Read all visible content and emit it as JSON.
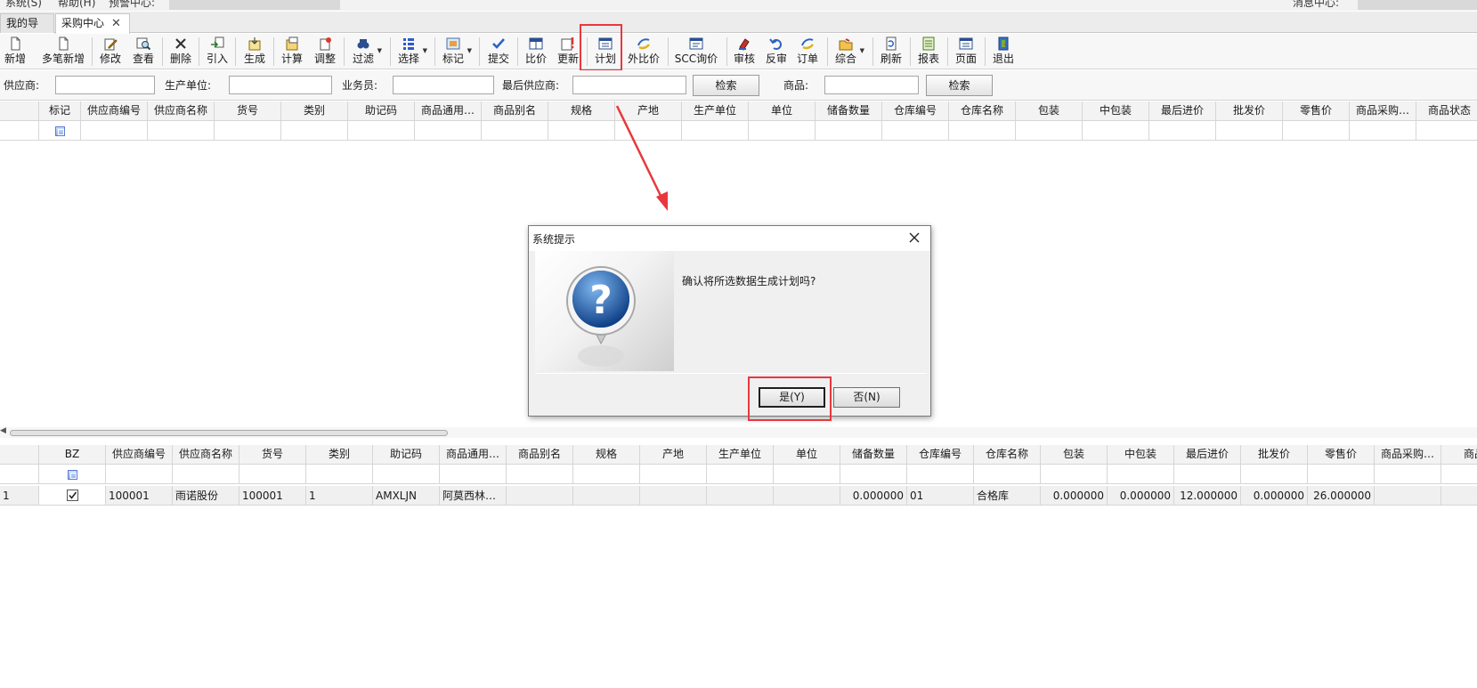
{
  "menubar": {
    "system": "系统(S)",
    "help": "帮助(H)",
    "alert_center": "预警中心:",
    "message_center": "消息中心:"
  },
  "tabs": [
    {
      "label": "我的导航"
    },
    {
      "label": "采购中心",
      "close": "✕"
    }
  ],
  "toolbar": {
    "items": [
      {
        "label": "新增",
        "icon": "new-doc-icon"
      },
      {
        "label": "多笔新增",
        "icon": "multi-new-icon"
      },
      {
        "label": "修改",
        "icon": "edit-icon"
      },
      {
        "label": "查看",
        "icon": "view-icon"
      },
      {
        "label": "删除",
        "icon": "delete-icon"
      },
      {
        "label": "引入",
        "icon": "import-icon"
      },
      {
        "label": "生成",
        "icon": "generate-icon"
      },
      {
        "label": "计算",
        "icon": "calculate-icon"
      },
      {
        "label": "调整",
        "icon": "adjust-icon"
      },
      {
        "label": "过滤",
        "icon": "filter-icon"
      },
      {
        "label": "选择",
        "icon": "select-icon"
      },
      {
        "label": "标记",
        "icon": "mark-icon"
      },
      {
        "label": "提交",
        "icon": "submit-icon"
      },
      {
        "label": "比价",
        "icon": "compare-icon"
      },
      {
        "label": "更新",
        "icon": "update-icon"
      },
      {
        "label": "计划",
        "icon": "plan-icon"
      },
      {
        "label": "外比价",
        "icon": "external-compare-icon"
      },
      {
        "label": "SCC询价",
        "icon": "scc-inquiry-icon"
      },
      {
        "label": "审核",
        "icon": "audit-icon"
      },
      {
        "label": "反审",
        "icon": "unaudit-icon"
      },
      {
        "label": "订单",
        "icon": "order-icon"
      },
      {
        "label": "综合",
        "icon": "comprehensive-icon"
      },
      {
        "label": "刷新",
        "icon": "refresh-icon"
      },
      {
        "label": "报表",
        "icon": "report-icon"
      },
      {
        "label": "页面",
        "icon": "page-icon"
      },
      {
        "label": "退出",
        "icon": "exit-icon"
      }
    ]
  },
  "search": {
    "supplier_label": "供应商:",
    "manufacturer_label": "生产单位:",
    "salesman_label": "业务员:",
    "last_supplier_label": "最后供应商:",
    "search_button_1": "检索",
    "product_label": "商品:",
    "search_button_2": "检索"
  },
  "top_grid": {
    "columns": [
      "",
      "标记",
      "供应商编号",
      "供应商名称",
      "货号",
      "类别",
      "助记码",
      "商品通用…",
      "商品别名",
      "规格",
      "产地",
      "生产单位",
      "单位",
      "储备数量",
      "仓库编号",
      "仓库名称",
      "包装",
      "中包装",
      "最后进价",
      "批发价",
      "零售价",
      "商品采购…",
      "商品状态"
    ]
  },
  "bottom_grid": {
    "columns": [
      "",
      "BZ",
      "供应商编号",
      "供应商名称",
      "货号",
      "类别",
      "助记码",
      "商品通用…",
      "商品别名",
      "规格",
      "产地",
      "生产单位",
      "单位",
      "储备数量",
      "仓库编号",
      "仓库名称",
      "包装",
      "中包装",
      "最后进价",
      "批发价",
      "零售价",
      "商品采购…",
      "商品"
    ],
    "rows": [
      {
        "cells": [
          "1",
          "",
          "100001",
          "雨诺股份",
          "100001",
          "1",
          "AMXLJN",
          "阿莫西林…",
          "",
          "",
          "",
          "",
          "",
          "0.000000",
          "01",
          "合格库",
          "0.000000",
          "0.000000",
          "12.000000",
          "0.000000",
          "26.000000",
          "",
          ""
        ],
        "checked": true
      }
    ]
  },
  "dialog": {
    "title": "系统提示",
    "message": "确认将所选数据生成计划吗?",
    "yes_button": "是(Y)",
    "no_button": "否(N)"
  }
}
